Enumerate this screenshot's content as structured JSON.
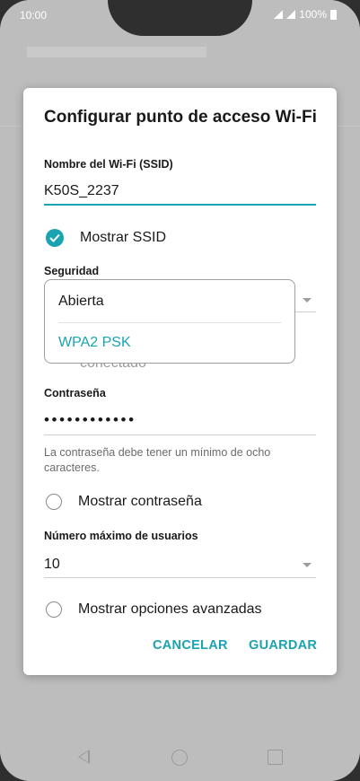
{
  "status_bar": {
    "time": "10:00",
    "battery": "100%"
  },
  "dialog": {
    "title": "Configurar punto de acceso Wi-Fi",
    "ssid_label": "Nombre del Wi-Fi (SSID)",
    "ssid_value": "K50S_2237",
    "show_ssid_label": "Mostrar SSID",
    "show_ssid_checked": true,
    "security_label": "Seguridad",
    "security_options": [
      "Abierta",
      "WPA2 PSK"
    ],
    "security_selected": "WPA2 PSK",
    "behind_text": "conectado",
    "password_label": "Contraseña",
    "password_value": "••••••••••••",
    "password_hint": "La contraseña debe tener un mínimo de ocho caracteres.",
    "show_password_label": "Mostrar contraseña",
    "max_users_label": "Número máximo de usuarios",
    "max_users_value": "10",
    "advanced_label": "Mostrar opciones avanzadas",
    "cancel_label": "CANCELAR",
    "save_label": "GUARDAR"
  },
  "colors": {
    "accent": "#1aa3b0",
    "text": "#1a1a1a",
    "hint": "#6b6b6b"
  }
}
